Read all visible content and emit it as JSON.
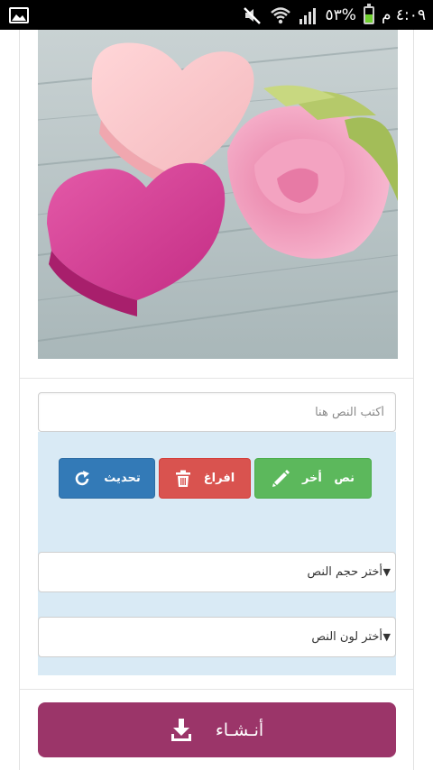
{
  "status_bar": {
    "time": "٤:٠٩ م",
    "battery": "٥٣%",
    "battery_level": 0.53,
    "icons": [
      "gallery-icon",
      "mute-icon",
      "wifi-icon",
      "signal-icon",
      "battery-icon"
    ]
  },
  "editor": {
    "text_placeholder": "أكتب النص هنا",
    "refresh_label": "تحديث",
    "clear_label": "افراغ",
    "other_text_label": "نص   أخر",
    "font_size_select": "أختر حجم النص",
    "font_color_select": "أختر لون النص",
    "create_label": "أنـشـاء"
  },
  "colors": {
    "refresh": "#337ab7",
    "clear": "#d9534f",
    "other_text": "#5cb85c",
    "create": "#9b3569",
    "panel": "#d9eaf5"
  }
}
